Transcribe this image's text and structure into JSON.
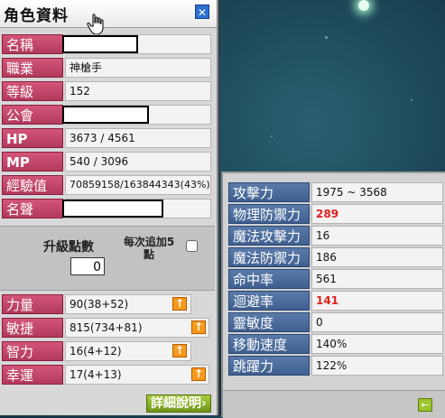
{
  "window": {
    "title": "角色資料"
  },
  "info": [
    {
      "label": "名稱",
      "value": "",
      "redacted": true
    },
    {
      "label": "職業",
      "value": "神槍手",
      "redacted": false
    },
    {
      "label": "等級",
      "value": "152",
      "redacted": false
    },
    {
      "label": "公會",
      "value": "",
      "redacted": true
    },
    {
      "label": "HP",
      "value": "3673 / 4561",
      "redacted": false
    },
    {
      "label": "MP",
      "value": "540 / 3096",
      "redacted": false
    },
    {
      "label": "經驗值",
      "value": "70859158/163844343(43%)",
      "redacted": false
    },
    {
      "label": "名聲",
      "value": "",
      "redacted": true
    }
  ],
  "points": {
    "upgrade_label": "升級點數",
    "upgrade_value": "0",
    "per_add_label": "每次追加5點"
  },
  "stats": [
    {
      "label": "力量",
      "value": "90(38+52)"
    },
    {
      "label": "敏捷",
      "value": "815(734+81)"
    },
    {
      "label": "智力",
      "value": "16(4+12)"
    },
    {
      "label": "幸運",
      "value": "17(4+13)"
    }
  ],
  "detail_button": "詳細說明",
  "details": [
    {
      "label": "攻擊力",
      "value": "1975 ~ 3568",
      "highlight": false
    },
    {
      "label": "物理防禦力",
      "value": "289",
      "highlight": true
    },
    {
      "label": "魔法攻擊力",
      "value": "16",
      "highlight": false
    },
    {
      "label": "魔法防禦力",
      "value": "186",
      "highlight": false
    },
    {
      "label": "命中率",
      "value": "561",
      "highlight": false
    },
    {
      "label": "迴避率",
      "value": "141",
      "highlight": true
    },
    {
      "label": "靈敏度",
      "value": "0",
      "highlight": false
    },
    {
      "label": "移動速度",
      "value": "140%",
      "highlight": false
    },
    {
      "label": "跳躍力",
      "value": "122%",
      "highlight": false
    }
  ],
  "icons": {
    "close": "close-icon",
    "cursor": "hand-cursor-icon",
    "stat_up": "arrow-up-icon",
    "collapse": "arrow-left-icon"
  },
  "colors": {
    "label_pink": "#c2446b",
    "label_blue": "#4a6a9c",
    "highlight_red": "#e0201a",
    "button_green": "#8db52a",
    "stat_up_orange": "#f59a1c"
  }
}
